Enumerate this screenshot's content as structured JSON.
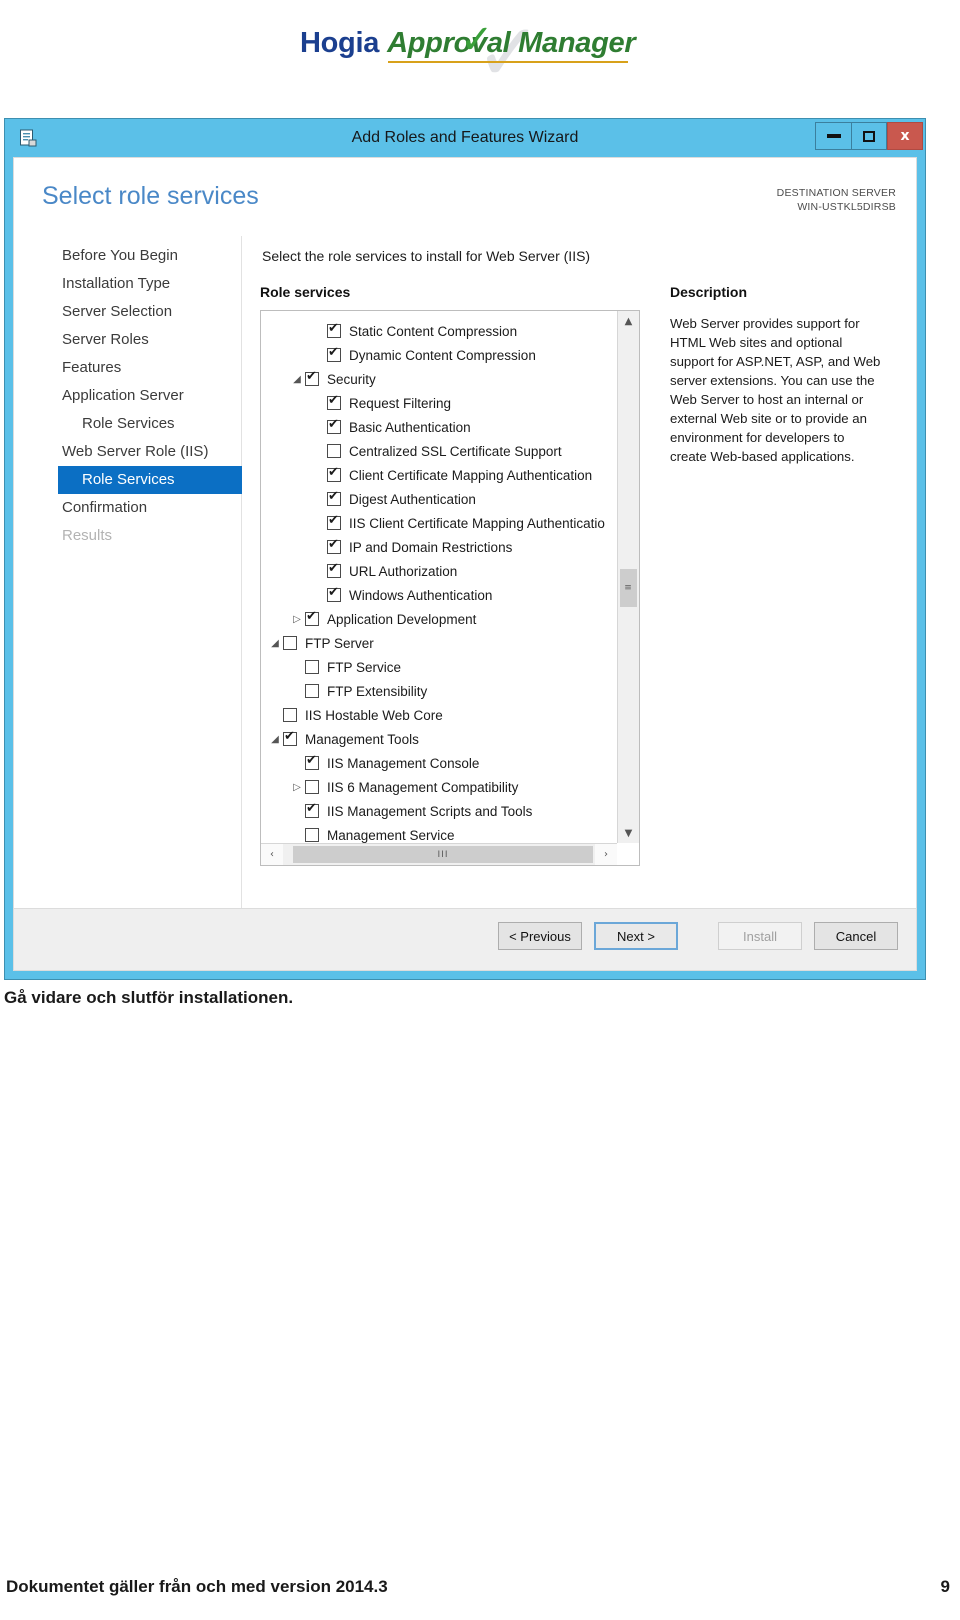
{
  "logo": {
    "brand": "Hogia",
    "product": "Approval Manager"
  },
  "window": {
    "title": "Add Roles and Features Wizard",
    "app_icon": "wizard-icon",
    "controls": {
      "minimize": "minimize-icon",
      "maximize": "maximize-icon",
      "close": "x"
    }
  },
  "page": {
    "title": "Select role services",
    "destination_label": "DESTINATION SERVER",
    "destination_server": "WIN-USTKL5DIRSB",
    "intro": "Select the role services to install for Web Server (IIS)",
    "role_services_label": "Role services",
    "description_label": "Description",
    "description_body": "Web Server provides support for HTML Web sites and optional support for ASP.NET, ASP, and Web server extensions. You can use the Web Server to host an internal or external Web site or to provide an environment for developers to create Web-based applications."
  },
  "nav": {
    "items": [
      {
        "label": "Before You Begin",
        "indent": 0,
        "state": "normal"
      },
      {
        "label": "Installation Type",
        "indent": 0,
        "state": "normal"
      },
      {
        "label": "Server Selection",
        "indent": 0,
        "state": "normal"
      },
      {
        "label": "Server Roles",
        "indent": 0,
        "state": "normal"
      },
      {
        "label": "Features",
        "indent": 0,
        "state": "normal"
      },
      {
        "label": "Application Server",
        "indent": 0,
        "state": "normal"
      },
      {
        "label": "Role Services",
        "indent": 1,
        "state": "normal"
      },
      {
        "label": "Web Server Role (IIS)",
        "indent": 0,
        "state": "normal"
      },
      {
        "label": "Role Services",
        "indent": 1,
        "state": "selected"
      },
      {
        "label": "Confirmation",
        "indent": 0,
        "state": "normal"
      },
      {
        "label": "Results",
        "indent": 0,
        "state": "dim"
      }
    ]
  },
  "tree": {
    "rows": [
      {
        "label": "Static Content Compression",
        "indent": 2,
        "checked": true,
        "expander": "none"
      },
      {
        "label": "Dynamic Content Compression",
        "indent": 2,
        "checked": true,
        "expander": "none"
      },
      {
        "label": "Security",
        "indent": 1,
        "checked": true,
        "expander": "expanded"
      },
      {
        "label": "Request Filtering",
        "indent": 2,
        "checked": true,
        "expander": "none"
      },
      {
        "label": "Basic Authentication",
        "indent": 2,
        "checked": true,
        "expander": "none"
      },
      {
        "label": "Centralized SSL Certificate Support",
        "indent": 2,
        "checked": false,
        "expander": "none"
      },
      {
        "label": "Client Certificate Mapping Authentication",
        "indent": 2,
        "checked": true,
        "expander": "none"
      },
      {
        "label": "Digest Authentication",
        "indent": 2,
        "checked": true,
        "expander": "none"
      },
      {
        "label": "IIS Client Certificate Mapping Authenticatio",
        "indent": 2,
        "checked": true,
        "expander": "none"
      },
      {
        "label": "IP and Domain Restrictions",
        "indent": 2,
        "checked": true,
        "expander": "none"
      },
      {
        "label": "URL Authorization",
        "indent": 2,
        "checked": true,
        "expander": "none"
      },
      {
        "label": "Windows Authentication",
        "indent": 2,
        "checked": true,
        "expander": "none"
      },
      {
        "label": "Application Development",
        "indent": 1,
        "checked": true,
        "expander": "collapsed"
      },
      {
        "label": "FTP Server",
        "indent": 0,
        "checked": false,
        "expander": "expanded"
      },
      {
        "label": "FTP Service",
        "indent": 1,
        "checked": false,
        "expander": "none"
      },
      {
        "label": "FTP Extensibility",
        "indent": 1,
        "checked": false,
        "expander": "none"
      },
      {
        "label": "IIS Hostable Web Core",
        "indent": 0,
        "checked": false,
        "expander": "none"
      },
      {
        "label": "Management Tools",
        "indent": 0,
        "checked": true,
        "expander": "expanded"
      },
      {
        "label": "IIS Management Console",
        "indent": 1,
        "checked": true,
        "expander": "none"
      },
      {
        "label": "IIS 6 Management Compatibility",
        "indent": 1,
        "checked": false,
        "expander": "collapsed"
      },
      {
        "label": "IIS Management Scripts and Tools",
        "indent": 1,
        "checked": true,
        "expander": "none"
      },
      {
        "label": "Management Service",
        "indent": 1,
        "checked": false,
        "expander": "none"
      }
    ],
    "vscroll": {
      "up": "▲",
      "down": "▼",
      "thumb": "≡"
    },
    "hscroll": {
      "left": "‹",
      "right": "›",
      "thumb": "III"
    }
  },
  "buttons": {
    "previous": "< Previous",
    "next": "Next >",
    "install": "Install",
    "cancel": "Cancel"
  },
  "document": {
    "caption": "Gå vidare och slutför installationen.",
    "footer_text": "Dokumentet gäller från och med version 2014.3",
    "page_number": "9"
  },
  "colors": {
    "titlebar": "#5bc0e8",
    "close_button": "#c9584e",
    "nav_selected": "#0b6fc4",
    "page_title": "#4a88c7",
    "brand_blue": "#1b3f8f",
    "brand_green": "#2f7d32",
    "brand_gold": "#d8a11a"
  }
}
